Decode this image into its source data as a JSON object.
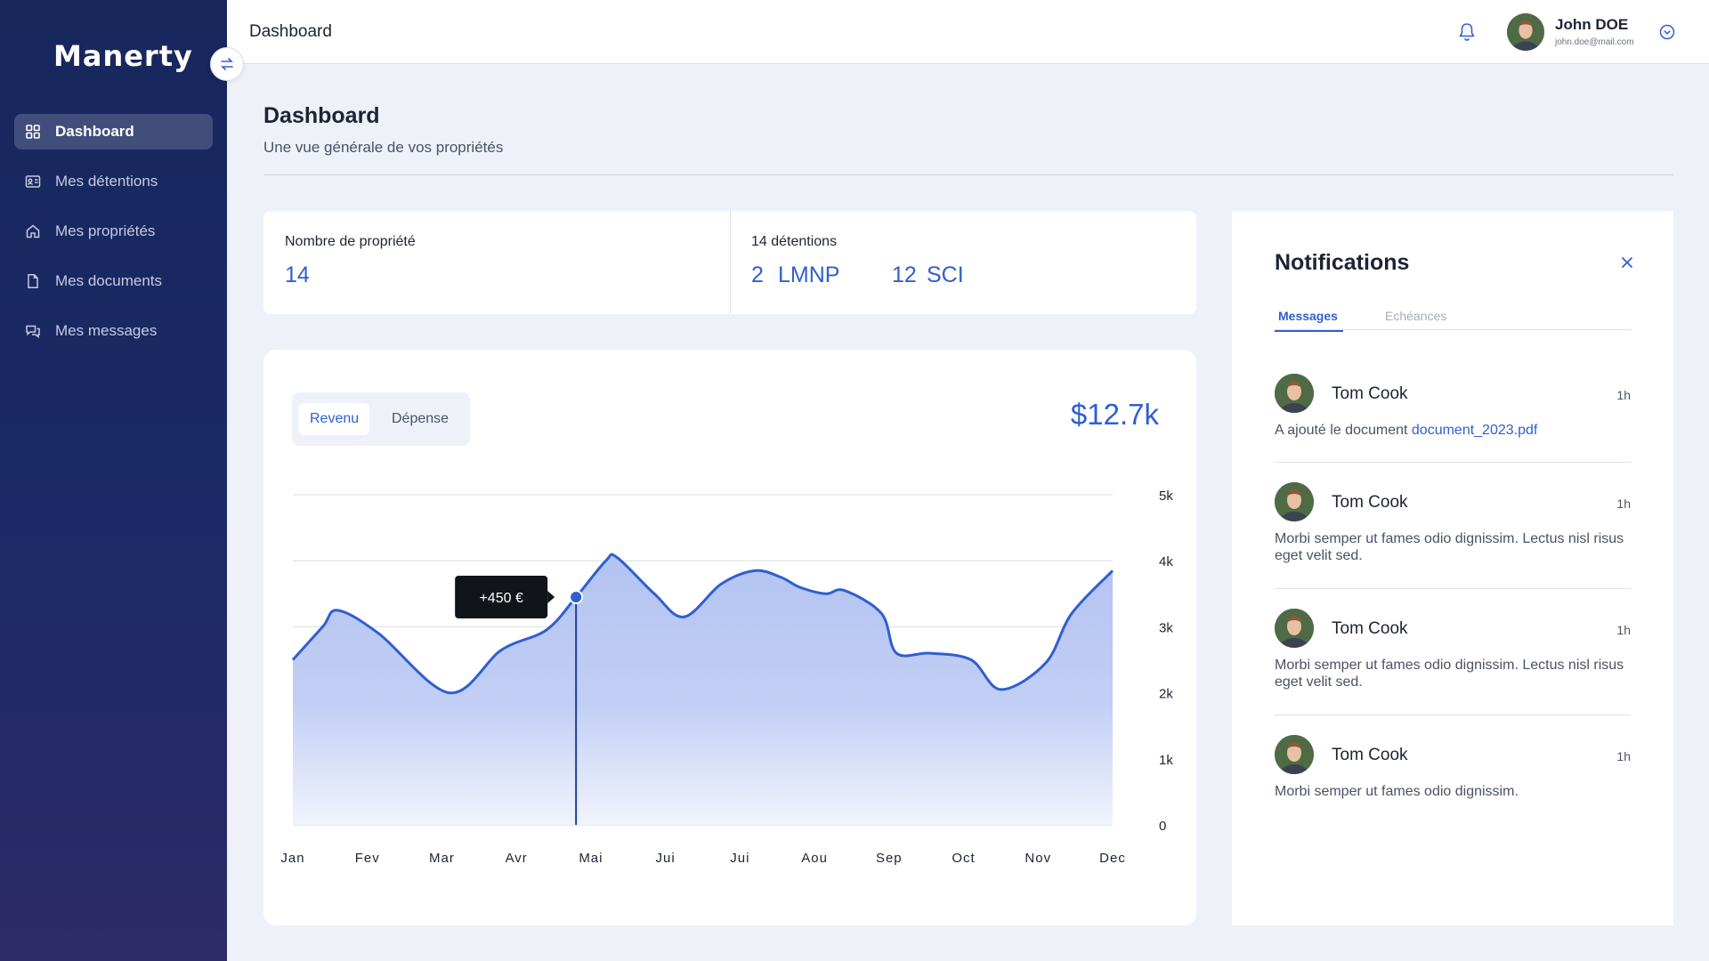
{
  "app": {
    "brand": "Manerty"
  },
  "header": {
    "title": "Dashboard",
    "user": {
      "name": "John DOE",
      "email": "john.doe@mail.com"
    }
  },
  "sidebar": {
    "items": [
      {
        "label": "Dashboard",
        "icon": "grid-icon",
        "active": true
      },
      {
        "label": "Mes détentions",
        "icon": "id-card-icon",
        "active": false
      },
      {
        "label": "Mes propriétés",
        "icon": "home-icon",
        "active": false
      },
      {
        "label": "Mes documents",
        "icon": "document-icon",
        "active": false
      },
      {
        "label": "Mes messages",
        "icon": "chat-icon",
        "active": false
      }
    ]
  },
  "page": {
    "title": "Dashboard",
    "subtitle": "Une vue générale de vos propriétés"
  },
  "stats": {
    "properties_label": "Nombre de propriété",
    "properties_value": "14",
    "holdings_label": "14 détentions",
    "lmnp_count": "2",
    "lmnp_label": "LMNP",
    "sci_count": "12",
    "sci_label": "SCI"
  },
  "chart": {
    "tab_active": "Revenu",
    "tab_inactive": "Dépense",
    "total": "$12.7k",
    "tooltip": "+450 €"
  },
  "chart_data": {
    "type": "area",
    "categories": [
      "Jan",
      "Fev",
      "Mar",
      "Avr",
      "Mai",
      "Jui",
      "Jui",
      "Aou",
      "Sep",
      "Oct",
      "Nov",
      "Dec"
    ],
    "x": [
      0,
      0.4,
      0.6,
      1.15,
      2.1,
      2.8,
      3.4,
      3.8,
      4.2,
      4.35,
      4.85,
      5.25,
      5.75,
      6.2,
      6.55,
      6.8,
      7.15,
      7.4,
      7.9,
      8.1,
      8.55,
      9.1,
      9.5,
      10.1,
      10.45,
      11.0
    ],
    "values": [
      2.5,
      3.0,
      3.25,
      2.9,
      2.0,
      2.65,
      2.95,
      3.45,
      4.0,
      4.05,
      3.5,
      3.15,
      3.65,
      3.85,
      3.75,
      3.6,
      3.5,
      3.55,
      3.2,
      2.6,
      2.6,
      2.5,
      2.05,
      2.45,
      3.2,
      3.85
    ],
    "ylim": [
      0,
      5
    ],
    "yticks": [
      "0",
      "1k",
      "2k",
      "3k",
      "4k",
      "5k"
    ],
    "highlight_index": 7,
    "grid": true,
    "series_color": "#2f5fd0",
    "fill_color": "#b8c7f2"
  },
  "notifications": {
    "title": "Notifications",
    "tabs": [
      "Messages",
      "Echéances"
    ],
    "items": [
      {
        "name": "Tom Cook",
        "time": "1h",
        "text": "A ajouté le document ",
        "link": "document_2023.pdf"
      },
      {
        "name": "Tom Cook",
        "time": "1h",
        "text": "Morbi semper ut fames odio dignissim. Lectus nisl risus eget velit sed."
      },
      {
        "name": "Tom Cook",
        "time": "1h",
        "text": "Morbi semper ut fames odio dignissim. Lectus nisl risus eget velit sed."
      },
      {
        "name": "Tom Cook",
        "time": "1h",
        "text": "Morbi semper ut fames odio dignissim."
      }
    ]
  },
  "colors": {
    "sidebar": "#17275c",
    "accent": "#2f5fd0",
    "background": "#eef1f8"
  }
}
